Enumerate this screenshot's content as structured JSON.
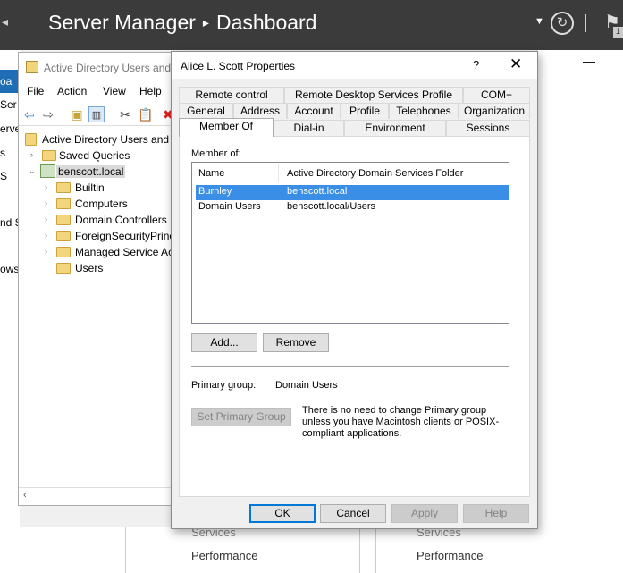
{
  "server_manager": {
    "title": "Server Manager",
    "breadcrumb_sep": "▸",
    "page": "Dashboard",
    "left_nav": {
      "selected": "oa",
      "items": [
        "Ser",
        "erver",
        "s",
        "S",
        "nd S",
        "ows"
      ]
    },
    "tiles": {
      "left_services": "Services",
      "left_performance": "Performance",
      "right_services": "Services",
      "right_performance": "Performance"
    },
    "flag_badge": "1"
  },
  "aduc": {
    "title": "Active Directory Users and",
    "menu": [
      "File",
      "Action",
      "View",
      "Help"
    ],
    "tree": {
      "root": "Active Directory Users and C",
      "saved_queries": "Saved Queries",
      "domain": "benscott.local",
      "children": [
        "Builtin",
        "Computers",
        "Domain Controllers",
        "ForeignSecurityPrinc",
        "Managed Service Ac",
        "Users"
      ]
    }
  },
  "dialog": {
    "title": "Alice L. Scott Properties",
    "help": "?",
    "close": "✕",
    "tabs_row1": [
      "Remote control",
      "Remote Desktop Services Profile",
      "COM+"
    ],
    "tabs_row2": [
      "General",
      "Address",
      "Account",
      "Profile",
      "Telephones",
      "Organization"
    ],
    "tabs_row3": [
      "Member Of",
      "Dial-in",
      "Environment",
      "Sessions"
    ],
    "member_of_label": "Member of:",
    "columns": [
      "Name",
      "Active Directory Domain Services Folder"
    ],
    "rows": [
      {
        "name": "Burnley",
        "folder": "benscott.local"
      },
      {
        "name": "Domain Users",
        "folder": "benscott.local/Users"
      }
    ],
    "add_button": "Add...",
    "remove_button": "Remove",
    "primary_group_label": "Primary group:",
    "primary_group_value": "Domain Users",
    "set_primary_button": "Set Primary Group",
    "primary_note": "There is no need to change Primary group unless you have Macintosh clients or POSIX-compliant applications.",
    "ok": "OK",
    "cancel": "Cancel",
    "apply": "Apply",
    "help_button": "Help"
  }
}
